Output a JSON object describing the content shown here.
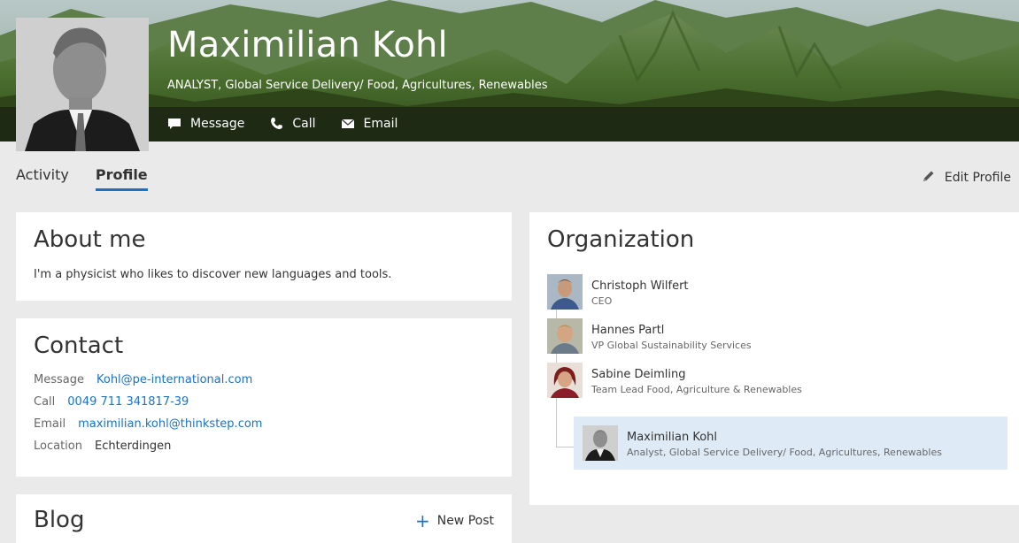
{
  "header": {
    "name": "Maximilian Kohl",
    "title": "ANALYST, Global Service Delivery/ Food, Agricultures, Renewables",
    "actions": [
      {
        "label": "Message",
        "icon": "message-icon"
      },
      {
        "label": "Call",
        "icon": "phone-icon"
      },
      {
        "label": "Email",
        "icon": "email-icon"
      }
    ]
  },
  "tabs": [
    {
      "label": "Activity",
      "active": false
    },
    {
      "label": "Profile",
      "active": true
    }
  ],
  "edit_profile_label": "Edit Profile",
  "about": {
    "heading": "About me",
    "text": "I'm a physicist who likes to discover new languages and tools."
  },
  "contact": {
    "heading": "Contact",
    "rows": [
      {
        "label": "Message",
        "value": "Kohl@pe-international.com"
      },
      {
        "label": "Call",
        "value": "0049 711 341817-39"
      },
      {
        "label": "Email",
        "value": "maximilian.kohl@thinkstep.com"
      },
      {
        "label": "Location",
        "value": "Echterdingen"
      }
    ]
  },
  "blog": {
    "heading": "Blog",
    "new_post_label": "New Post"
  },
  "organization": {
    "heading": "Organization",
    "people": [
      {
        "name": "Christoph Wilfert",
        "role": "CEO"
      },
      {
        "name": "Hannes Partl",
        "role": "VP Global Sustainability Services"
      },
      {
        "name": "Sabine Deimling",
        "role": "Team Lead Food, Agriculture & Renewables"
      },
      {
        "name": "Maximilian Kohl",
        "role": "Analyst, Global Service Delivery/ Food, Agricultures, Renewables"
      }
    ]
  },
  "colors": {
    "accent": "#1a73c4",
    "background": "#eaeaea",
    "self_highlight": "#deebf6"
  }
}
